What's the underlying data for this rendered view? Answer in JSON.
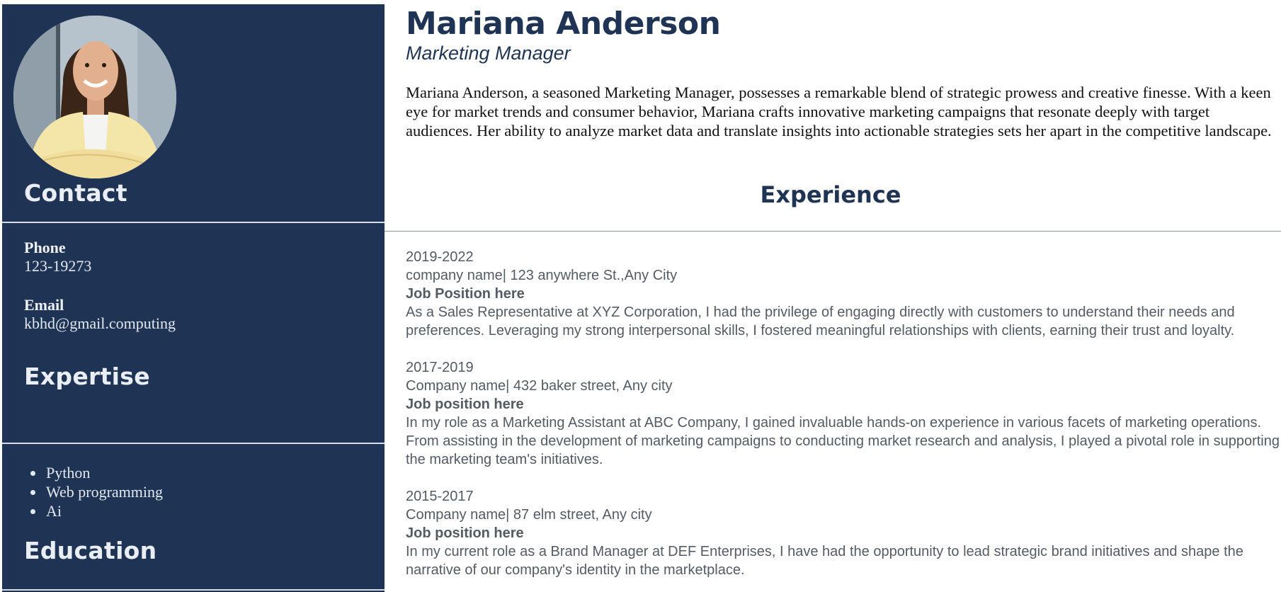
{
  "profile": {
    "name": "Mariana Anderson",
    "title": "Marketing Manager",
    "summary": "Mariana Anderson, a seasoned Marketing Manager, possesses a remarkable blend of strategic prowess and creative finesse. With a keen eye for market trends and consumer behavior, Mariana crafts innovative marketing campaigns that resonate deeply with target audiences. Her ability to analyze market data and translate insights into actionable strategies sets her apart in the competitive landscape."
  },
  "sidebar": {
    "contact_heading": "Contact",
    "phone_label": "Phone",
    "phone_value": "123-19273",
    "email_label": "Email",
    "email_value": "kbhd@gmail.computing",
    "expertise_heading": "Expertise",
    "skills": [
      "Python",
      "Web programming",
      "Ai"
    ],
    "education_heading": "Education"
  },
  "experience": {
    "heading": "Experience",
    "jobs": [
      {
        "period": "2019-2022",
        "company": "company name| 123 anywhere St.,Any City",
        "position": "Job Position here",
        "description": "As a Sales Representative at XYZ Corporation, I had the privilege of engaging directly with customers to understand their needs and preferences. Leveraging my strong interpersonal skills, I fostered meaningful relationships with clients, earning their trust and loyalty."
      },
      {
        "period": "2017-2019",
        "company": "Company name| 432 baker street, Any city",
        "position": "Job position here",
        "description": "In my role as a Marketing Assistant at ABC Company, I gained invaluable hands-on experience in various facets of marketing operations. From assisting in the development of marketing campaigns to conducting market research and analysis, I played a pivotal role in supporting the marketing team's initiatives."
      },
      {
        "period": "2015-2017",
        "company": "Company name| 87 elm street, Any city",
        "position": "Job position here",
        "description": "In my current role as a Brand Manager at DEF Enterprises, I have had the opportunity to lead strategic brand initiatives and shape the narrative of our company's identity in the marketplace."
      }
    ]
  },
  "colors": {
    "sidebar_bg": "#1f3454",
    "accent": "#1f3454",
    "body_text": "#555b63"
  }
}
